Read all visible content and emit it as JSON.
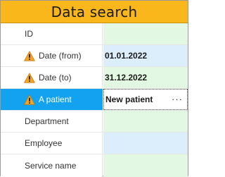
{
  "panel": {
    "title": "Data search"
  },
  "fields": [
    {
      "label": "ID",
      "value": "",
      "warning": false,
      "selected": false,
      "value_bg": "green"
    },
    {
      "label": "Date (from)",
      "value": "01.01.2022",
      "warning": true,
      "selected": false,
      "value_bg": "blue"
    },
    {
      "label": "Date (to)",
      "value": "31.12.2022",
      "warning": true,
      "selected": false,
      "value_bg": "green"
    },
    {
      "label": "A patient",
      "value": "New patient",
      "warning": true,
      "selected": true,
      "value_bg": "white",
      "button": "···"
    },
    {
      "label": "Department",
      "value": "",
      "warning": false,
      "selected": false,
      "value_bg": "green"
    },
    {
      "label": "Employee",
      "value": "",
      "warning": false,
      "selected": false,
      "value_bg": "blue"
    },
    {
      "label": "Service name",
      "value": "",
      "warning": false,
      "selected": false,
      "value_bg": "green"
    }
  ],
  "colors": {
    "title_bg": "#f9b71c",
    "selected_bg": "#12a2ef",
    "value_green": "#e2f8e2",
    "value_blue": "#dcedfc",
    "warning_fill": "#f5a623"
  },
  "icons": {
    "warning": "warning-triangle-icon"
  }
}
